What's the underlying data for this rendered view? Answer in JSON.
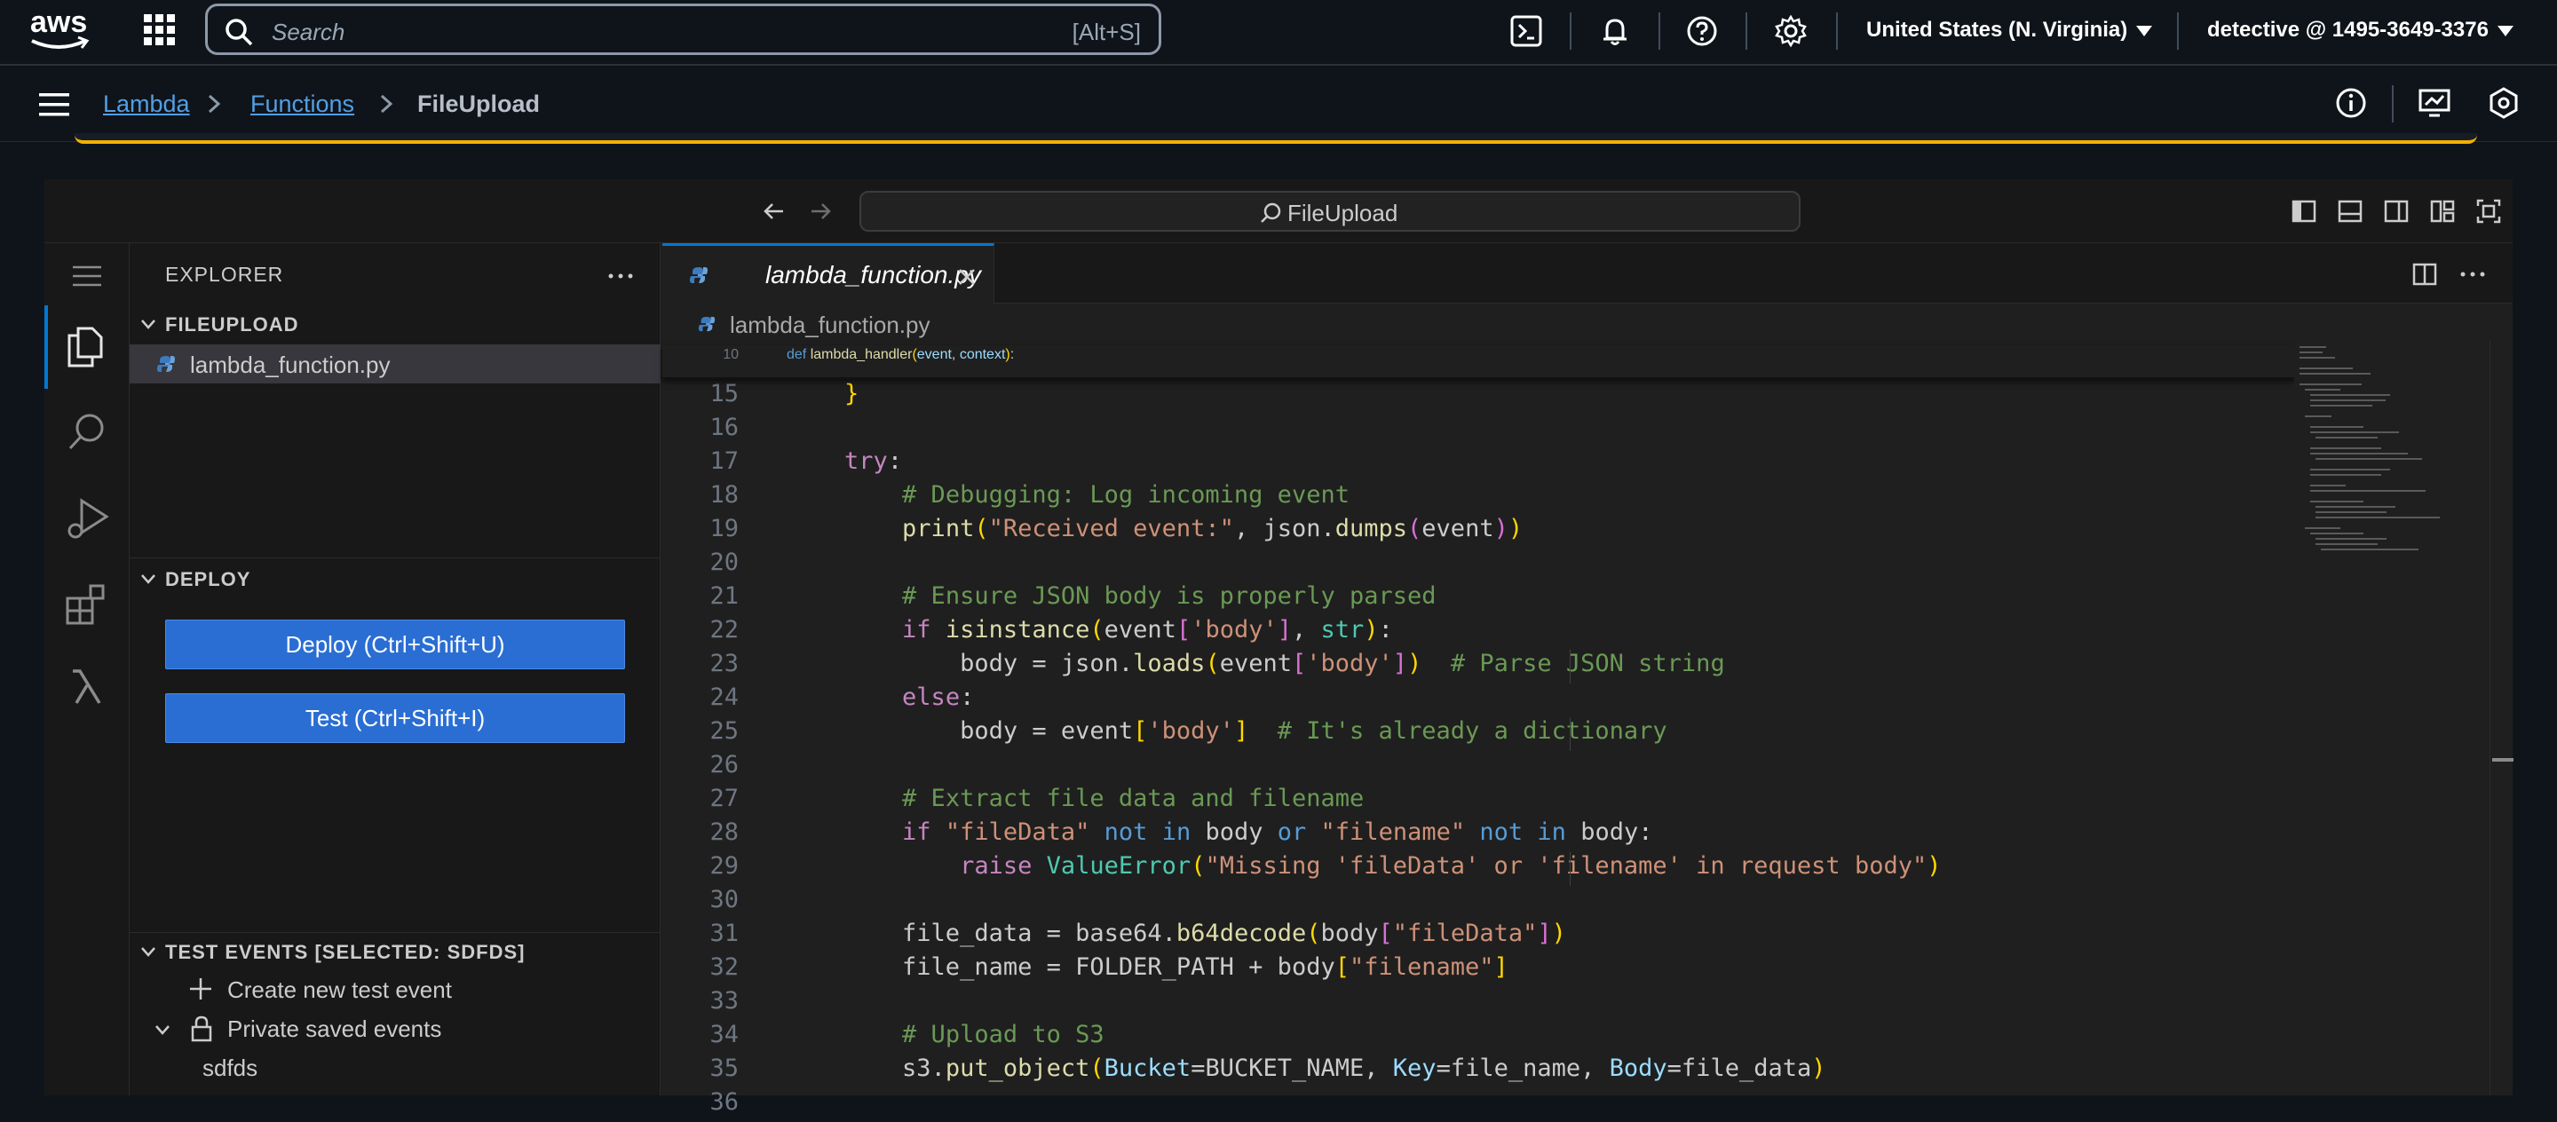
{
  "topbar": {
    "logo_text": "aws",
    "search_placeholder": "Search",
    "search_shortcut": "[Alt+S]",
    "region": "United States (N. Virginia)",
    "account": "detective @ 1495-3649-3376",
    "icons": [
      "cloudshell-icon",
      "bell-icon",
      "help-icon",
      "settings-icon"
    ]
  },
  "breadcrumb": {
    "items": [
      "Lambda",
      "Functions"
    ],
    "current": "FileUpload"
  },
  "ide": {
    "command_center": "FileUpload",
    "explorer_title": "EXPLORER",
    "project_folder": "FILEUPLOAD",
    "file_name": "lambda_function.py",
    "deploy_title": "DEPLOY",
    "deploy_button": "Deploy (Ctrl+Shift+U)",
    "test_button": "Test (Ctrl+Shift+I)",
    "test_events_title": "TEST EVENTS [SELECTED: SDFDS]",
    "create_test_event": "Create new test event",
    "private_saved_events": "Private saved events",
    "saved_event": "sdfds",
    "tab_label": "lambda_function.py",
    "editor_breadcrumb": "lambda_function.py"
  },
  "code": {
    "sticky": {
      "n": "10",
      "text": "def lambda_handler(event, context):"
    },
    "lines": [
      {
        "n": "15",
        "text": "    }"
      },
      {
        "n": "16",
        "text": ""
      },
      {
        "n": "17",
        "text": "    try:"
      },
      {
        "n": "18",
        "text": "        # Debugging: Log incoming event"
      },
      {
        "n": "19",
        "text": "        print(\"Received event:\", json.dumps(event))"
      },
      {
        "n": "20",
        "text": ""
      },
      {
        "n": "21",
        "text": "        # Ensure JSON body is properly parsed"
      },
      {
        "n": "22",
        "text": "        if isinstance(event['body'], str):"
      },
      {
        "n": "23",
        "text": "            body = json.loads(event['body'])  # Parse JSON string"
      },
      {
        "n": "24",
        "text": "        else:"
      },
      {
        "n": "25",
        "text": "            body = event['body']  # It's already a dictionary"
      },
      {
        "n": "26",
        "text": ""
      },
      {
        "n": "27",
        "text": "        # Extract file data and filename"
      },
      {
        "n": "28",
        "text": "        if \"fileData\" not in body or \"filename\" not in body:"
      },
      {
        "n": "29",
        "text": "            raise ValueError(\"Missing 'fileData' or 'filename' in request body\")"
      },
      {
        "n": "30",
        "text": ""
      },
      {
        "n": "31",
        "text": "        file_data = base64.b64decode(body[\"fileData\"])"
      },
      {
        "n": "32",
        "text": "        file_name = FOLDER_PATH + body[\"filename\"]"
      },
      {
        "n": "33",
        "text": ""
      },
      {
        "n": "34",
        "text": "        # Upload to S3"
      },
      {
        "n": "35",
        "text": "        s3.put_object(Bucket=BUCKET_NAME, Key=file_name, Body=file_data)"
      },
      {
        "n": "36",
        "text": ""
      }
    ]
  },
  "colors": {
    "accent": "#0078d4",
    "link": "#539fe5",
    "button": "#2a6ed3",
    "warning": "#f2b100"
  }
}
